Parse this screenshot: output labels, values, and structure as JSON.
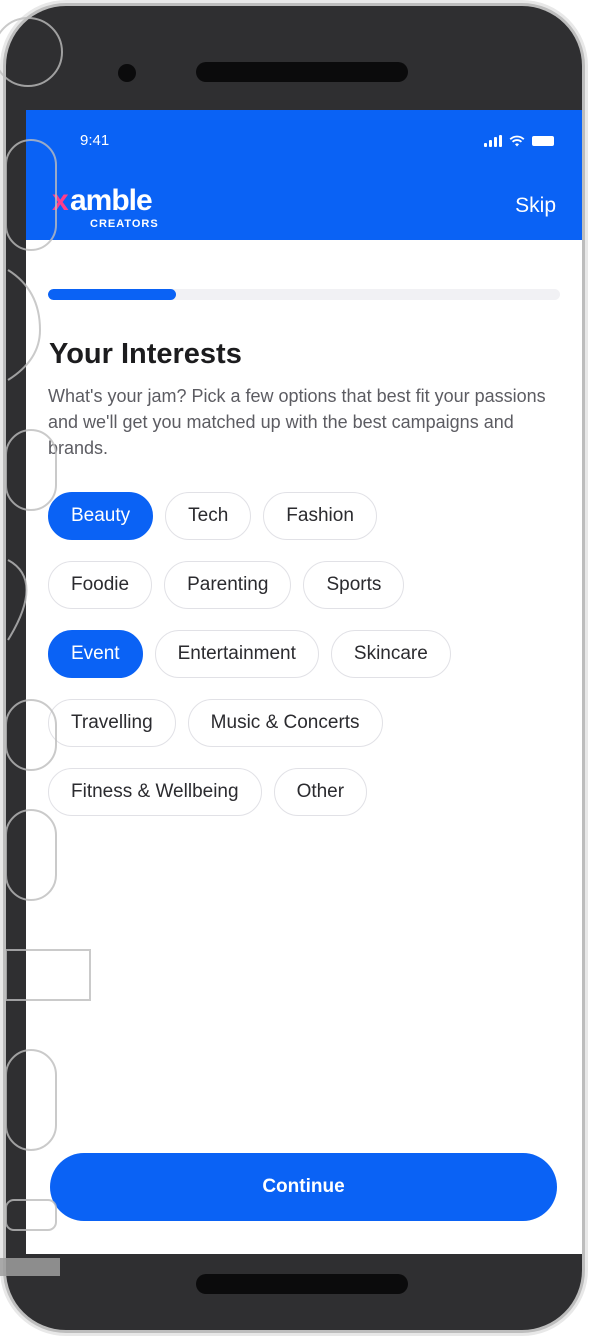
{
  "status_bar": {
    "time": "9:41"
  },
  "header": {
    "logo": {
      "x": "x",
      "word": "amble",
      "sub": "CREATORS"
    },
    "skip_label": "Skip"
  },
  "progress": {
    "value": 0.25
  },
  "content": {
    "title": "Your Interests",
    "subtitle": "What's your jam? Pick a few options that best fit your passions and we'll get you matched up with the best campaigns and brands."
  },
  "interests": [
    {
      "label": "Beauty",
      "selected": true
    },
    {
      "label": "Tech",
      "selected": false
    },
    {
      "label": "Fashion",
      "selected": false
    },
    {
      "label": "Foodie",
      "selected": false
    },
    {
      "label": "Parenting",
      "selected": false
    },
    {
      "label": "Sports",
      "selected": false
    },
    {
      "label": "Event",
      "selected": true
    },
    {
      "label": "Entertainment",
      "selected": false
    },
    {
      "label": "Skincare",
      "selected": false
    },
    {
      "label": "Travelling",
      "selected": false
    },
    {
      "label": "Music & Concerts",
      "selected": false
    },
    {
      "label": "Fitness & Wellbeing",
      "selected": false
    },
    {
      "label": "Other",
      "selected": false
    }
  ],
  "footer": {
    "continue_label": "Continue"
  },
  "colors": {
    "accent": "#0a62f5",
    "logo_x": "#ff3d8a",
    "device": "#2f2f31"
  },
  "icons": [
    "cellular-signal-icon",
    "wifi-icon",
    "battery-icon"
  ]
}
